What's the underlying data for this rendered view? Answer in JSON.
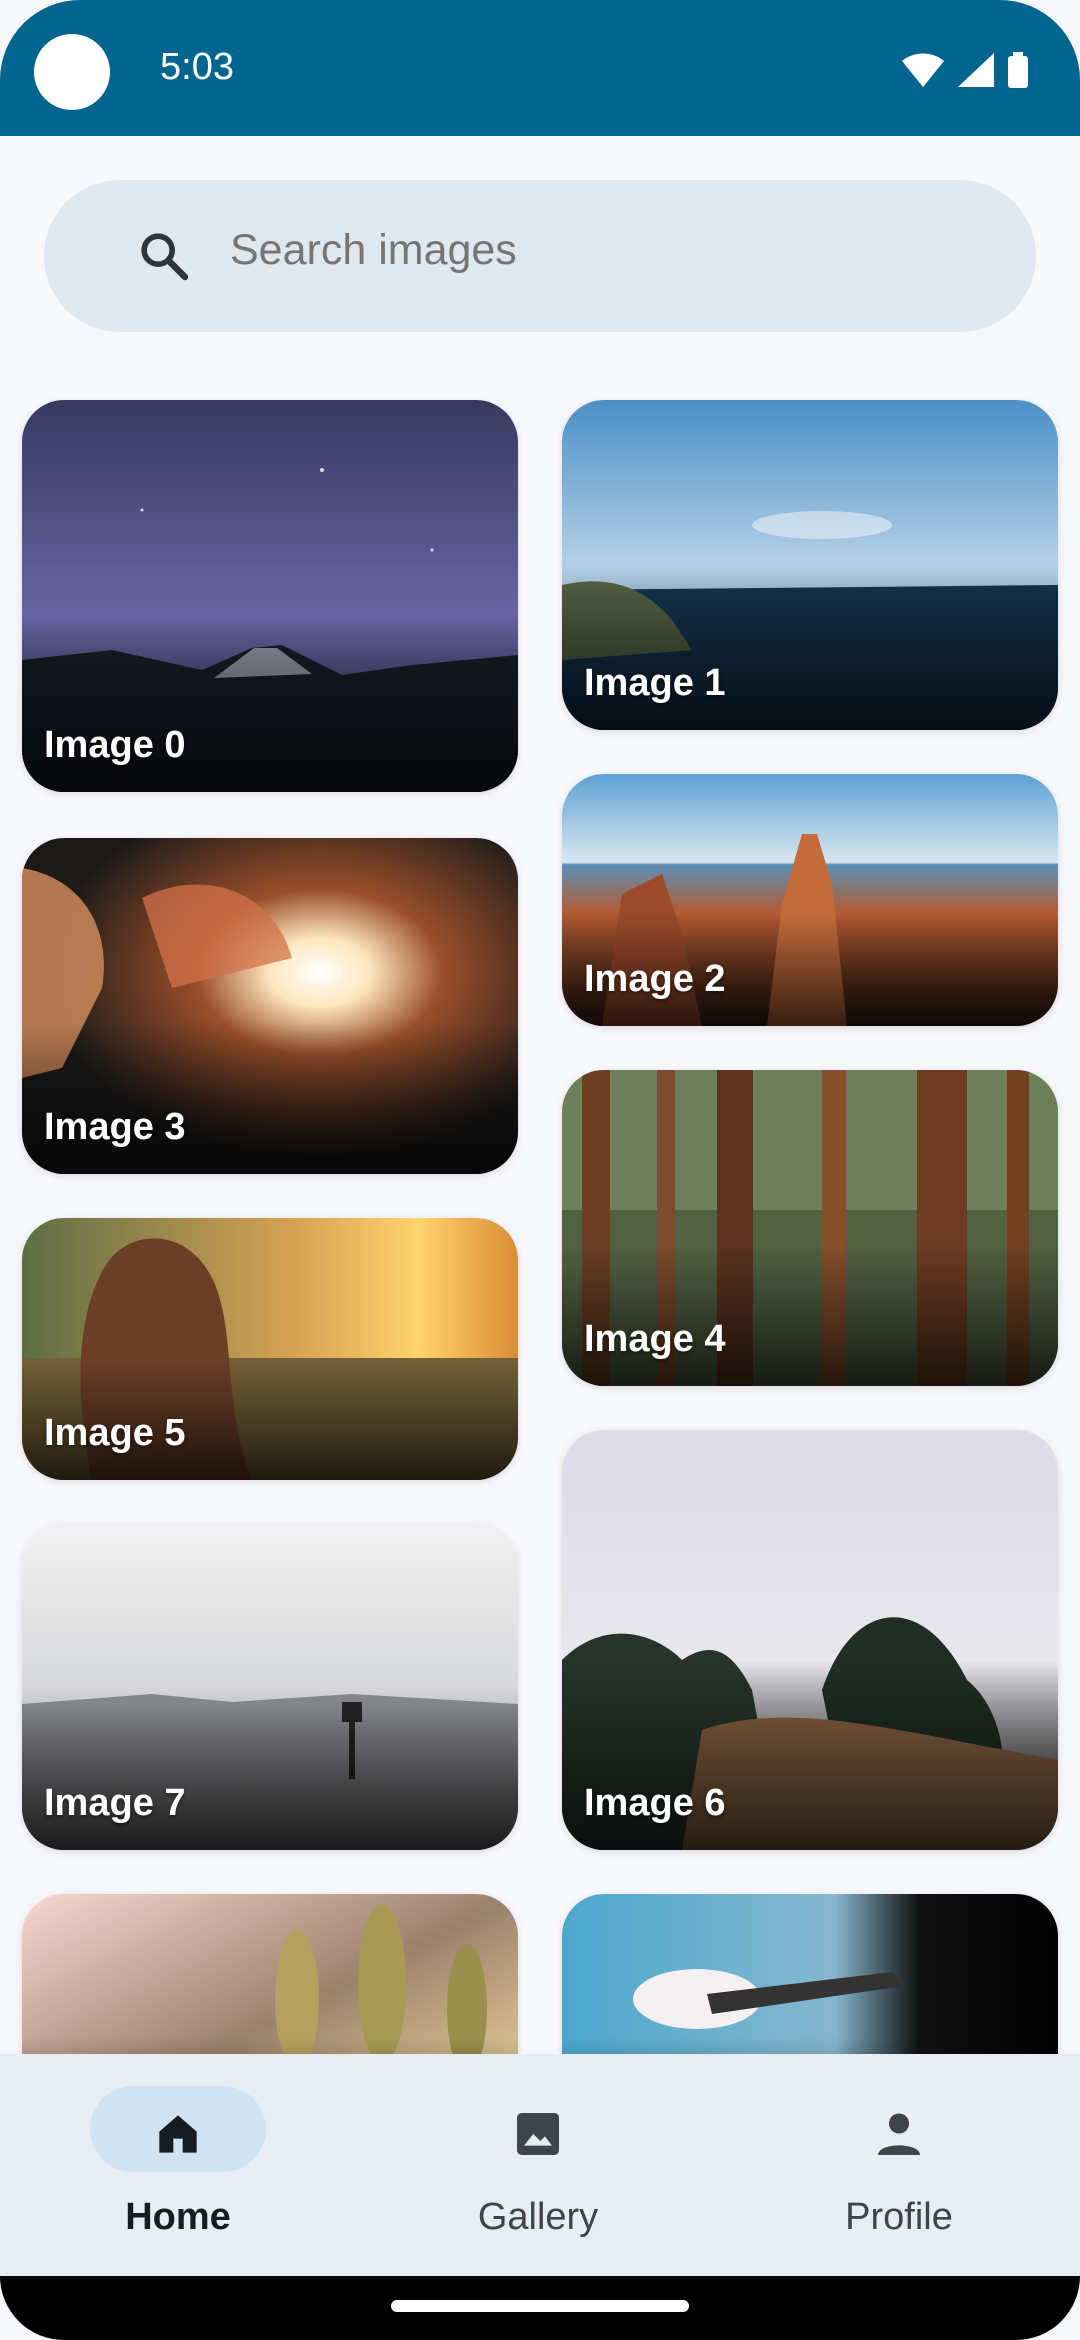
{
  "status_bar": {
    "time": "5:03",
    "icons": [
      "wifi-icon",
      "signal-icon",
      "battery-icon"
    ]
  },
  "search": {
    "placeholder": "Search images",
    "icon": "search-icon"
  },
  "grid": {
    "images": [
      {
        "label": "Image 0"
      },
      {
        "label": "Image 1"
      },
      {
        "label": "Image 2"
      },
      {
        "label": "Image 3"
      },
      {
        "label": "Image 4"
      },
      {
        "label": "Image 5"
      },
      {
        "label": "Image 6"
      },
      {
        "label": "Image 7"
      }
    ]
  },
  "bottom_nav": {
    "items": [
      {
        "label": "Home",
        "icon": "home-icon",
        "active": true
      },
      {
        "label": "Gallery",
        "icon": "image-icon",
        "active": false
      },
      {
        "label": "Profile",
        "icon": "person-icon",
        "active": false
      }
    ]
  },
  "colors": {
    "status_bar": "#01658f",
    "search_bg": "#dfe8ee",
    "nav_bg": "#e7edf3",
    "active_pill": "#cfe3f2"
  }
}
